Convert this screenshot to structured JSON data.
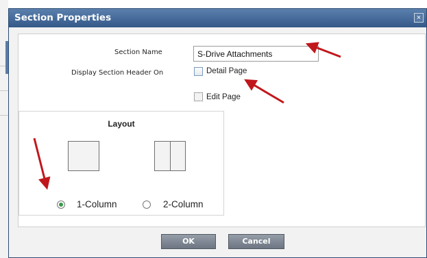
{
  "dialog": {
    "title": "Section Properties",
    "close_glyph": "×"
  },
  "form": {
    "section_name_label": "Section Name",
    "section_name_value": "S-Drive Attachments",
    "display_header_label": "Display Section Header On",
    "detail_page_label": "Detail Page",
    "detail_page_checked": false,
    "edit_page_label": "Edit Page",
    "edit_page_checked": false
  },
  "layout": {
    "title": "Layout",
    "options": [
      {
        "label": "1-Column",
        "selected": true
      },
      {
        "label": "2-Column",
        "selected": false
      }
    ]
  },
  "buttons": {
    "ok": "OK",
    "cancel": "Cancel"
  },
  "colors": {
    "titlebar": "#3f6594",
    "arrow": "#c0171c",
    "radio_selected": "#3a9a4a"
  },
  "icons": {
    "one_column": "one-column-layout-icon",
    "two_column": "two-column-layout-icon",
    "close": "close-icon",
    "arrow": "red-arrow-annotation"
  }
}
